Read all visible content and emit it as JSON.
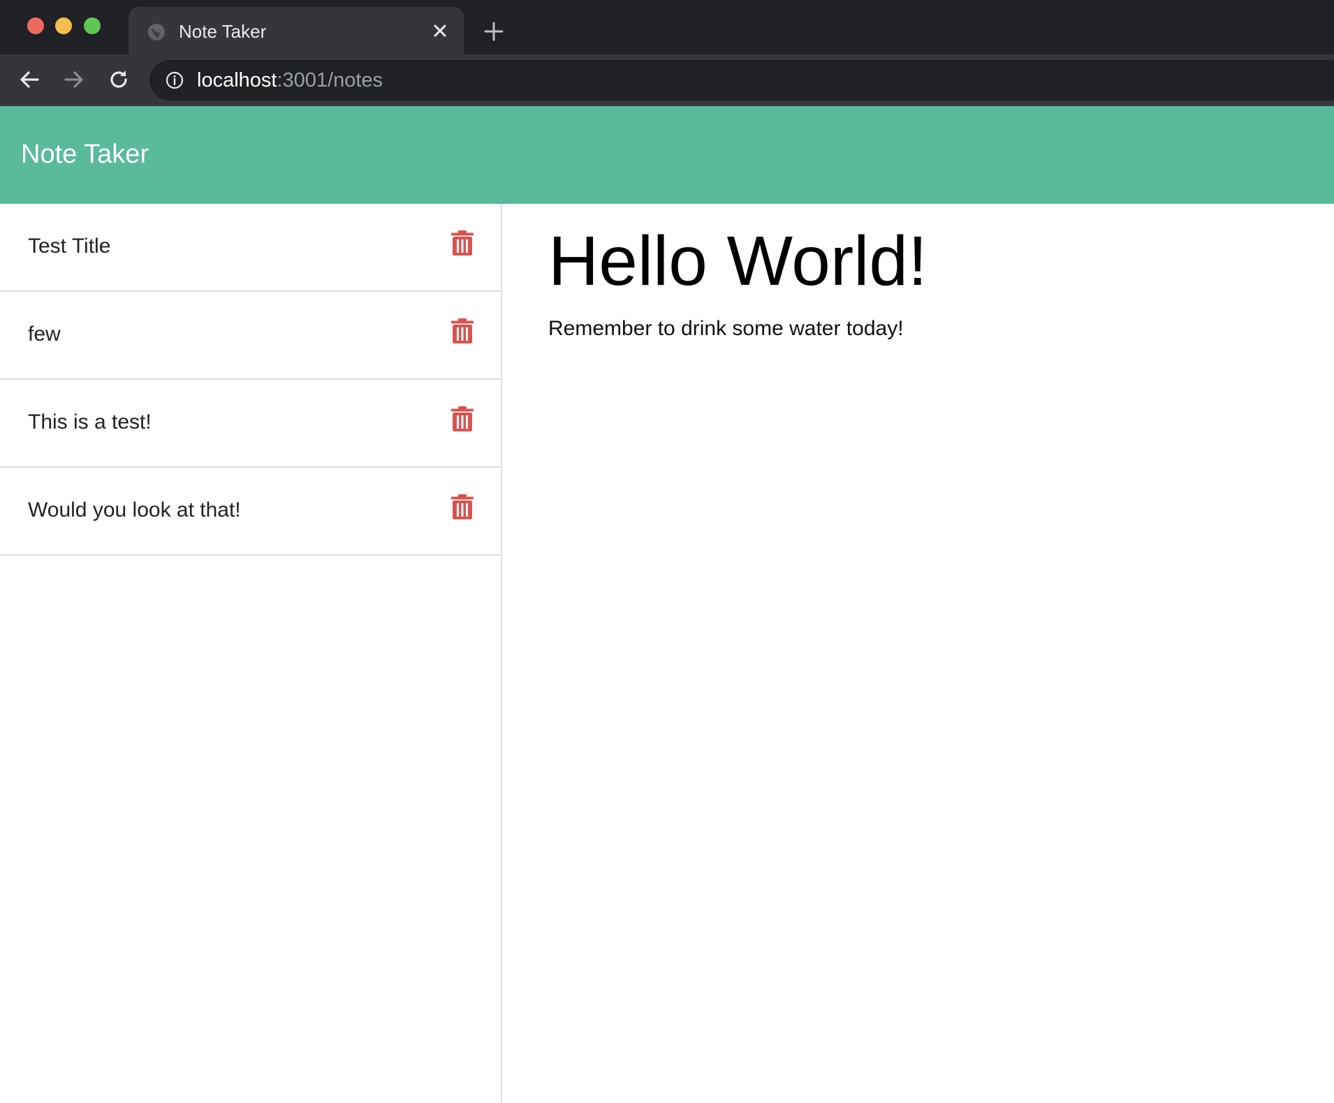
{
  "browser": {
    "tab_title": "Note Taker",
    "url_host": "localhost",
    "url_path": ":3001/notes"
  },
  "app": {
    "title": "Note Taker",
    "accent_color": "#5aba9c",
    "delete_color": "#d9534f"
  },
  "notes": [
    {
      "title": "Test Title"
    },
    {
      "title": "few"
    },
    {
      "title": "This is a test!"
    },
    {
      "title": "Would you look at that!"
    }
  ],
  "active_note": {
    "title": "Hello World!",
    "text": "Remember to drink some water today!"
  },
  "icons": {
    "delete": "trash-icon",
    "back": "arrow-left-icon",
    "forward": "arrow-right-icon",
    "reload": "reload-icon",
    "info": "info-icon",
    "close": "close-icon",
    "new_tab": "plus-icon",
    "favicon": "globe-icon"
  }
}
